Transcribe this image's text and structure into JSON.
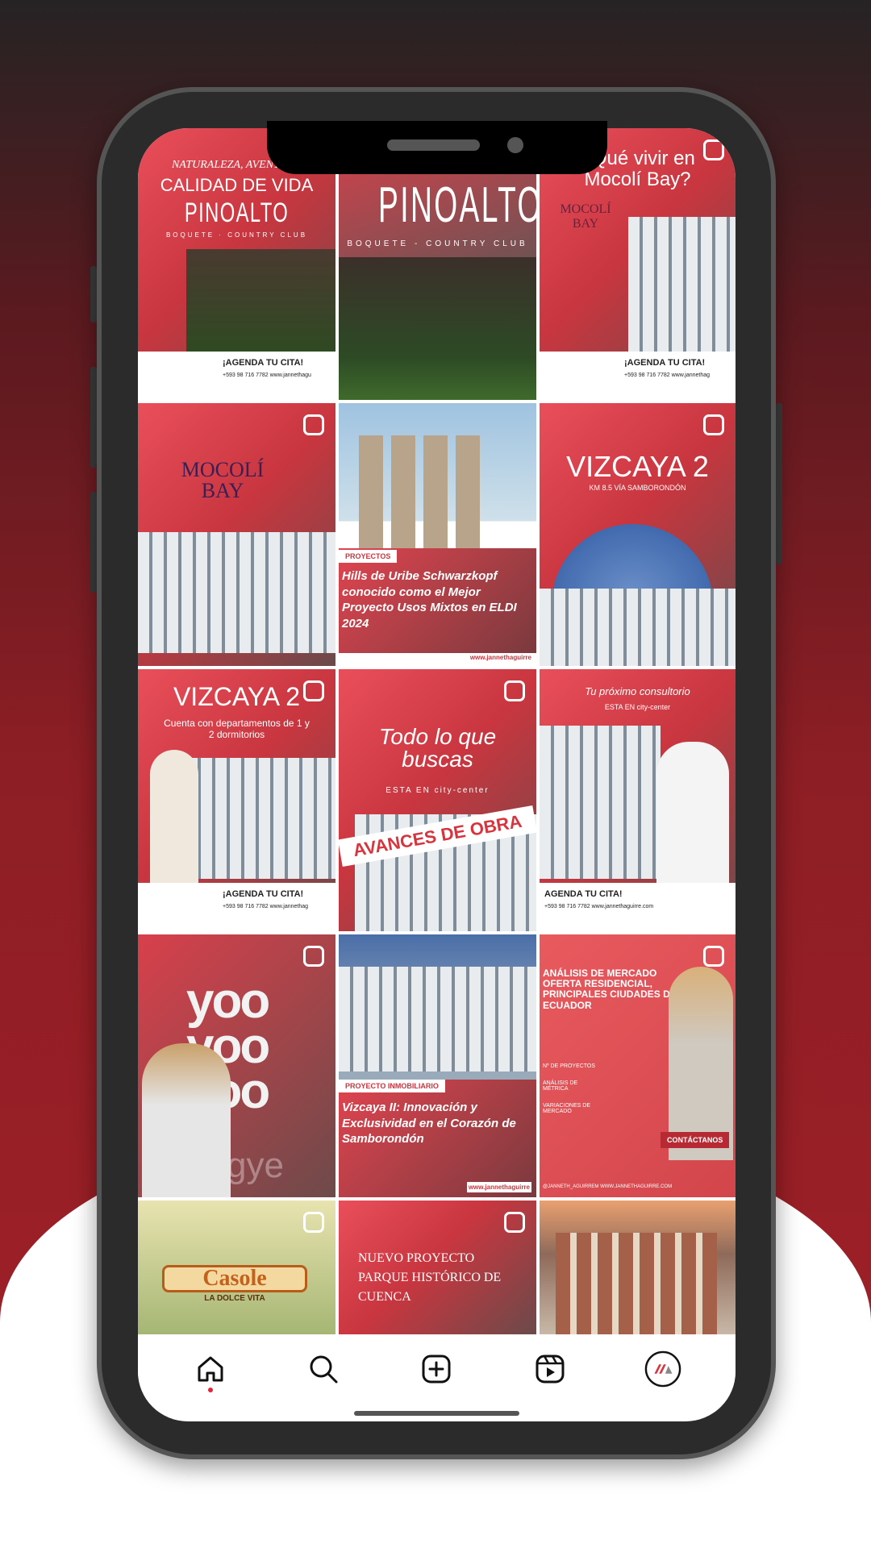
{
  "posts": [
    {
      "top": "NATURALEZA, AVENTURA",
      "title": "CALIDAD DE VIDA",
      "brand": "PINOALTO",
      "sub": "BOQUETE · COUNTRY CLUB",
      "cta": "¡AGENDA TU CITA!",
      "contact": "+593 98 716 7782   www.jannethagu"
    },
    {
      "brand": "PINOALTO",
      "sub": "BOQUETE - COUNTRY CLUB"
    },
    {
      "title": "¿Qué vivir en Mocolí Bay?",
      "brand": "MOCOLÍ BAY",
      "cta": "¡AGENDA TU CITA!",
      "contact": "+593 98 716 7782   www.jannethag"
    },
    {
      "brand": "MOCOLÍ BAY"
    },
    {
      "tag": "PROYECTOS",
      "text": "Hills de Uribe Schwarzkopf conocido como el Mejor Proyecto Usos Mixtos en ELDI 2024",
      "url": "www.jannethaguirre"
    },
    {
      "title": "VIZCAYA 2",
      "sub": "KM 8.5 VÍA SAMBORONDÓN"
    },
    {
      "title": "VIZCAYA 2",
      "sub": "Cuenta con departamentos de 1 y 2 dormitorios",
      "cta": "¡AGENDA TU CITA!",
      "contact": "+593 98 716 7782   www.jannethag"
    },
    {
      "title": "Todo lo que buscas",
      "sub": "ESTA EN city-center",
      "banner": "AVANCES DE OBRA"
    },
    {
      "title": "Tu próximo consultorio",
      "sub": "ESTA EN city-center",
      "cta": "AGENDA TU CITA!",
      "contact": "+593 98 716 7782   www.jannethaguirre.com"
    },
    {
      "title": "yoo yoo yoo",
      "sub": "gye"
    },
    {
      "tag": "PROYECTO INMOBILIARIO",
      "text": "Vizcaya II: Innovación y Exclusividad en el Corazón de Samborondón",
      "url": "www.jannethaguirre"
    },
    {
      "title": "ANÁLISIS DE MERCADO OFERTA RESIDENCIAL, PRINCIPALES CIUDADES DEL ECUADOR",
      "items": [
        "Nº DE PROYECTOS",
        "ANÁLISIS DE MÉTRICA",
        "VARIACIONES DE MERCADO"
      ],
      "cta": "CONTÁCTANOS",
      "contact": "@JANNETH_AGUIRREM   WWW.JANNETHAGUIRRE.COM"
    },
    {
      "brand": "Casole",
      "sub": "LA DOLCE VITA"
    },
    {
      "title": "NUEVO PROYECTO PARQUE HISTÓRICO DE CUENCA"
    },
    {}
  ],
  "nav": [
    "home-icon",
    "search-icon",
    "create-icon",
    "reels-icon",
    "profile-avatar"
  ],
  "colors": {
    "accent": "#d8343e",
    "background_dark": "#262324",
    "background_red": "#9a1f26"
  }
}
